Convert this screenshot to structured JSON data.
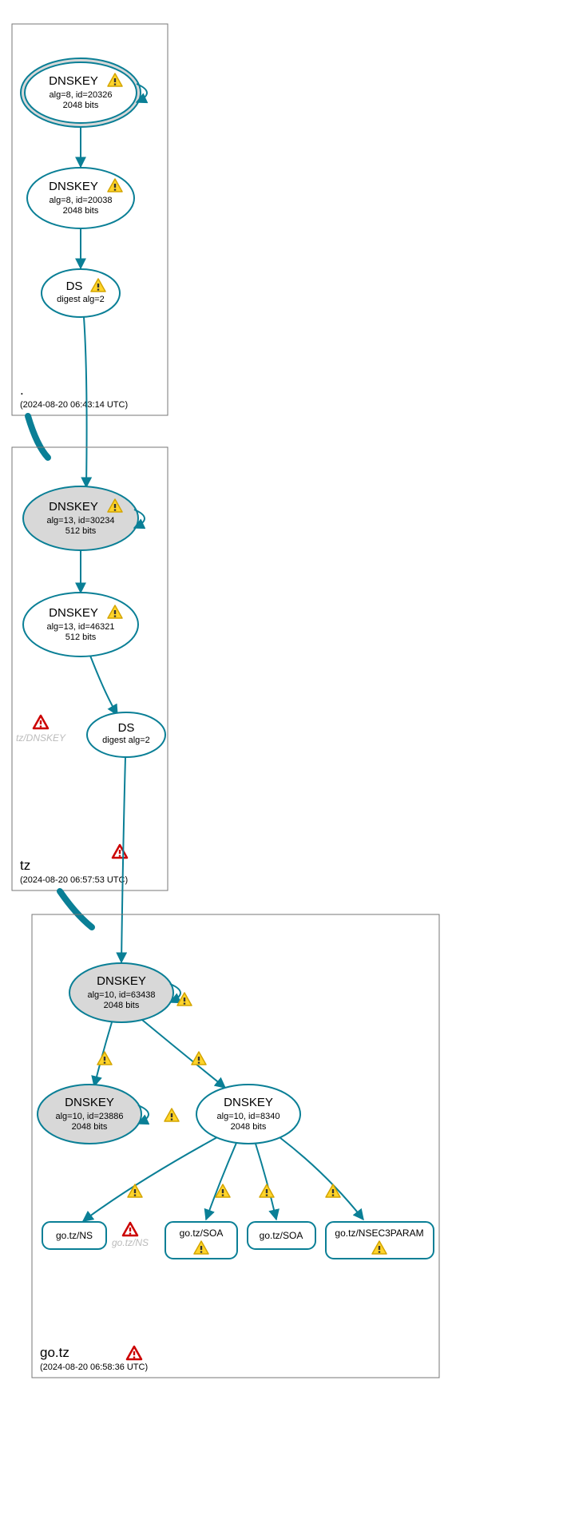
{
  "zones": {
    "root": {
      "name": ".",
      "timestamp": "(2024-08-20 06:43:14 UTC)"
    },
    "tz": {
      "name": "tz",
      "timestamp": "(2024-08-20 06:57:53 UTC)"
    },
    "gotz": {
      "name": "go.tz",
      "timestamp": "(2024-08-20 06:58:36 UTC)"
    }
  },
  "nodes": {
    "root_ksk": {
      "l1": "DNSKEY",
      "l2": "alg=8, id=20326",
      "l3": "2048 bits"
    },
    "root_zsk": {
      "l1": "DNSKEY",
      "l2": "alg=8, id=20038",
      "l3": "2048 bits"
    },
    "root_ds": {
      "l1": "DS",
      "l2": "digest alg=2"
    },
    "tz_ksk": {
      "l1": "DNSKEY",
      "l2": "alg=13, id=30234",
      "l3": "512 bits"
    },
    "tz_zsk": {
      "l1": "DNSKEY",
      "l2": "alg=13, id=46321",
      "l3": "512 bits"
    },
    "tz_ds": {
      "l1": "DS",
      "l2": "digest alg=2"
    },
    "tz_ghost": {
      "l1": "tz/DNSKEY"
    },
    "go_ksk": {
      "l1": "DNSKEY",
      "l2": "alg=10, id=63438",
      "l3": "2048 bits"
    },
    "go_zsk2": {
      "l1": "DNSKEY",
      "l2": "alg=10, id=23886",
      "l3": "2048 bits"
    },
    "go_zsk": {
      "l1": "DNSKEY",
      "l2": "alg=10, id=8340",
      "l3": "2048 bits"
    },
    "go_ns": {
      "l1": "go.tz/NS"
    },
    "go_ns_ghost": {
      "l1": "go.tz/NS"
    },
    "go_soa1": {
      "l1": "go.tz/SOA"
    },
    "go_soa2": {
      "l1": "go.tz/SOA"
    },
    "go_nsec": {
      "l1": "go.tz/NSEC3PARAM"
    }
  },
  "chart_data": {
    "type": "dnssec-chain",
    "zones": [
      {
        "name": ".",
        "timestamp": "2024-08-20 06:43:14 UTC",
        "keys": [
          {
            "type": "DNSKEY",
            "alg": 8,
            "id": 20326,
            "bits": 2048,
            "role": "KSK",
            "warn": true,
            "self_loop": true
          },
          {
            "type": "DNSKEY",
            "alg": 8,
            "id": 20038,
            "bits": 2048,
            "role": "ZSK",
            "warn": true
          }
        ],
        "ds": [
          {
            "digest_alg": 2,
            "warn": true
          }
        ]
      },
      {
        "name": "tz",
        "timestamp": "2024-08-20 06:57:53 UTC",
        "keys": [
          {
            "type": "DNSKEY",
            "alg": 13,
            "id": 30234,
            "bits": 512,
            "role": "KSK",
            "warn": true,
            "self_loop": true
          },
          {
            "type": "DNSKEY",
            "alg": 13,
            "id": 46321,
            "bits": 512,
            "role": "ZSK",
            "warn": true
          }
        ],
        "ds": [
          {
            "digest_alg": 2
          }
        ],
        "errors": [
          "tz/DNSKEY"
        ]
      },
      {
        "name": "go.tz",
        "timestamp": "2024-08-20 06:58:36 UTC",
        "keys": [
          {
            "type": "DNSKEY",
            "alg": 10,
            "id": 63438,
            "bits": 2048,
            "role": "KSK",
            "self_loop": true,
            "self_loop_warn": true
          },
          {
            "type": "DNSKEY",
            "alg": 10,
            "id": 23886,
            "bits": 2048,
            "self_loop": true,
            "self_loop_warn": true
          },
          {
            "type": "DNSKEY",
            "alg": 10,
            "id": 8340,
            "bits": 2048
          }
        ],
        "rrsets": [
          {
            "name": "go.tz/NS"
          },
          {
            "name": "go.tz/NS",
            "ghost": true,
            "error": true
          },
          {
            "name": "go.tz/SOA",
            "warn": true
          },
          {
            "name": "go.tz/SOA"
          },
          {
            "name": "go.tz/NSEC3PARAM",
            "warn": true
          }
        ],
        "edges_warn": [
          [
            "63438",
            "23886"
          ],
          [
            "63438",
            "8340"
          ],
          [
            "8340",
            "go.tz/NS"
          ],
          [
            "8340",
            "go.tz/SOA"
          ],
          [
            "8340",
            "go.tz/SOA"
          ],
          [
            "8340",
            "go.tz/NSEC3PARAM"
          ]
        ],
        "zone_error": true
      }
    ]
  }
}
